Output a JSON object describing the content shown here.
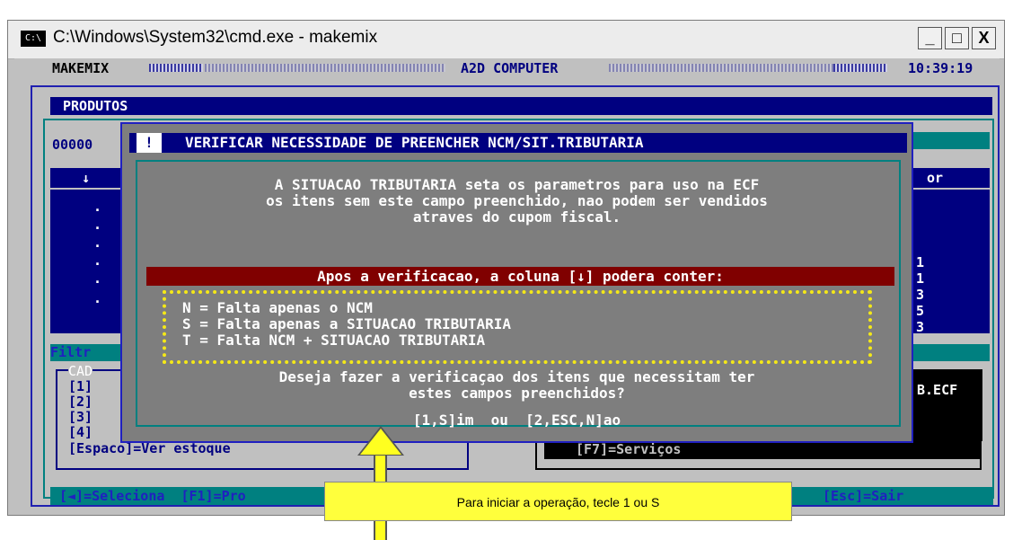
{
  "window": {
    "icon_label": "C:\\",
    "title": "C:\\Windows\\System32\\cmd.exe - makemix",
    "minimize": "_",
    "maximize": "□",
    "close": "X"
  },
  "status": {
    "app": "MAKEMIX",
    "company": "A2D COMPUTER",
    "time": "10:39:19"
  },
  "screen": {
    "title": "PRODUTOS",
    "code": "00000",
    "col_arrow": "↓",
    "col_right": "or",
    "row_dots": [
      ".",
      ".",
      ".",
      ".",
      ".",
      "."
    ],
    "right_digits": [
      "1",
      "1",
      "3",
      "5",
      "3"
    ],
    "filter_label": "Filtr",
    "cad_label": "CAD",
    "menu_keys": [
      "[1]",
      "[2]",
      "[3]",
      "[4]"
    ],
    "espaco": "[Espaco]=Ver estoque",
    "f7": "[F7]=Serviços",
    "ecf": "B.ECF",
    "footer_left": "[◄]=Seleciona  [F1]=Pro",
    "footer_right": "[Esc]=Sair"
  },
  "dialog": {
    "marker": "!",
    "title": "VERIFICAR NECESSIDADE DE PREENCHER NCM/SIT.TRIBUTARIA",
    "lines": [
      "A SITUACAO TRIBUTARIA seta os parametros para uso na ECF",
      "os itens sem este campo preenchido, nao podem ser vendidos",
      "atraves do cupom fiscal."
    ],
    "banner": "Apos a verificacao, a coluna [↓] podera conter:",
    "options": [
      "N = Falta apenas o NCM",
      "S = Falta apenas a SITUACAO TRIBUTARIA",
      "T = Falta NCM + SITUACAO TRIBUTARIA"
    ],
    "question": [
      "Deseja fazer a verificaçao dos itens que necessitam ter",
      "estes campos preenchidos?"
    ],
    "choice": "[1,S]im  ou  [2,ESC,N]ao"
  },
  "callout": {
    "text": "Para iniciar a operação, tecle 1 ou S"
  }
}
